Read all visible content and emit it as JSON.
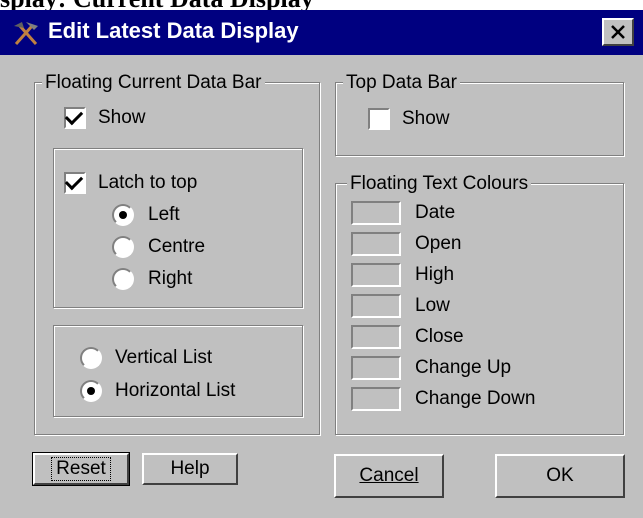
{
  "background_text": "splay: Current Data Display",
  "window": {
    "title": "Edit Latest Data Display",
    "title_icon": "hammer-pick-icon",
    "close_icon": "close-icon"
  },
  "floating_bar": {
    "title": "Floating Current Data Bar",
    "show": {
      "label": "Show",
      "checked": true
    },
    "latch": {
      "label": "Latch to top",
      "checked": true
    },
    "positions": [
      {
        "label": "Left",
        "selected": true
      },
      {
        "label": "Centre",
        "selected": false
      },
      {
        "label": "Right",
        "selected": false
      }
    ],
    "layouts": [
      {
        "label": "Vertical List",
        "selected": false
      },
      {
        "label": "Horizontal List",
        "selected": true
      }
    ]
  },
  "top_bar": {
    "title": "Top Data Bar",
    "show": {
      "label": "Show",
      "checked": false
    }
  },
  "colours": {
    "title": "Floating Text Colours",
    "items": [
      "Date",
      "Open",
      "High",
      "Low",
      "Close",
      "Change Up",
      "Change Down"
    ]
  },
  "buttons": {
    "reset": "Reset",
    "help": "Help",
    "cancel": "Cancel",
    "ok": "OK"
  }
}
